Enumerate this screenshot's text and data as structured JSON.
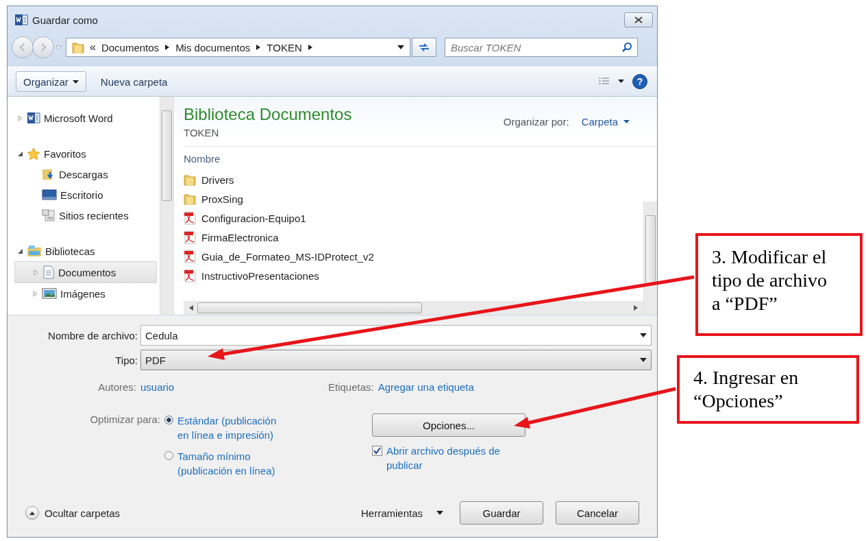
{
  "window": {
    "title": "Guardar como"
  },
  "address": {
    "overflow": "«",
    "breadcrumbs": [
      "Documentos",
      "Mis documentos",
      "TOKEN"
    ]
  },
  "search": {
    "placeholder": "Buscar TOKEN"
  },
  "toolbar": {
    "organize": "Organizar",
    "new_folder": "Nueva carpeta",
    "help": "?"
  },
  "nav": {
    "items": [
      {
        "label": "Microsoft Word",
        "kind": "word",
        "expanded": false,
        "selected": false
      },
      {
        "label": "Favoritos",
        "kind": "star",
        "expanded": true,
        "selected": false,
        "children": [
          {
            "label": "Descargas",
            "kind": "downloads",
            "selected": false
          },
          {
            "label": "Escritorio",
            "kind": "desktop",
            "selected": false
          },
          {
            "label": "Sitios recientes",
            "kind": "recent",
            "selected": false
          }
        ]
      },
      {
        "label": "Bibliotecas",
        "kind": "library",
        "expanded": true,
        "selected": false,
        "children": [
          {
            "label": "Documentos",
            "kind": "documents",
            "expanded": false,
            "selected": true
          },
          {
            "label": "Imágenes",
            "kind": "pictures",
            "expanded": false,
            "selected": false
          }
        ]
      }
    ]
  },
  "library": {
    "title": "Biblioteca Documentos",
    "subtitle": "TOKEN",
    "arrange_label": "Organizar por:",
    "arrange_value": "Carpeta"
  },
  "file_list": {
    "column": "Nombre",
    "files": [
      {
        "name": "Drivers",
        "kind": "folder"
      },
      {
        "name": "ProxSing",
        "kind": "folder"
      },
      {
        "name": "Configuracion-Equipo1",
        "kind": "pdf"
      },
      {
        "name": "FirmaElectronica",
        "kind": "pdf"
      },
      {
        "name": "Guia_de_Formateo_MS-IDProtect_v2",
        "kind": "pdf"
      },
      {
        "name": "InstructivoPresentaciones",
        "kind": "pdf"
      }
    ]
  },
  "form": {
    "file_name_label": "Nombre de archivo:",
    "file_name": "Cedula",
    "type_label": "Tipo:",
    "type": "PDF",
    "authors_label": "Autores:",
    "authors": "usuario",
    "tags_label": "Etiquetas:",
    "tags": "Agregar una etiqueta",
    "optimize_label": "Optimizar para:",
    "optimize_options": [
      {
        "label": "Estándar (publicación en línea e impresión)",
        "selected": true
      },
      {
        "label": "Tamaño mínimo (publicación en línea)",
        "selected": false
      }
    ],
    "options_button": "Opciones...",
    "open_after": {
      "label": "Abrir archivo después de publicar",
      "checked": true
    }
  },
  "footer": {
    "hide_folders": "Ocultar carpetas",
    "tools": "Herramientas",
    "save": "Guardar",
    "cancel": "Cancelar"
  },
  "annotations": [
    {
      "text": "3. Modificar el tipo de archivo a “PDF”"
    },
    {
      "text": "4. Ingresar en “Opciones”"
    }
  ]
}
